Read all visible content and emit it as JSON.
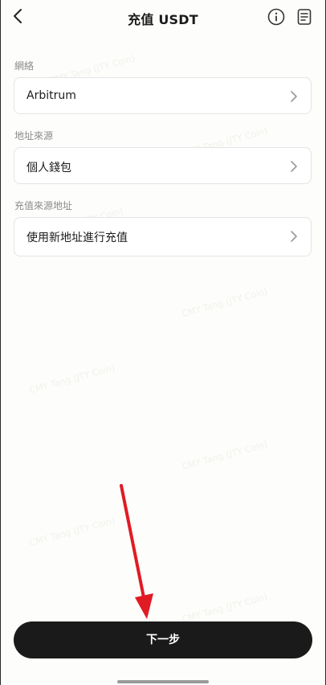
{
  "header": {
    "title": "充值 USDT",
    "icons": [
      "back-icon",
      "info-icon",
      "document-icon"
    ]
  },
  "sections": [
    {
      "label": "網絡",
      "value": "Arbitrum"
    },
    {
      "label": "地址來源",
      "value": "個人錢包"
    },
    {
      "label": "充值來源地址",
      "value": "使用新地址進行充值"
    }
  ],
  "footer": {
    "next_label": "下一步"
  },
  "watermark": "CMY Tang (JTY Coin)",
  "colors": {
    "primary_button": "#1a1a1a",
    "annotation_arrow": "#e01b24",
    "background": "#fdfdfb"
  }
}
